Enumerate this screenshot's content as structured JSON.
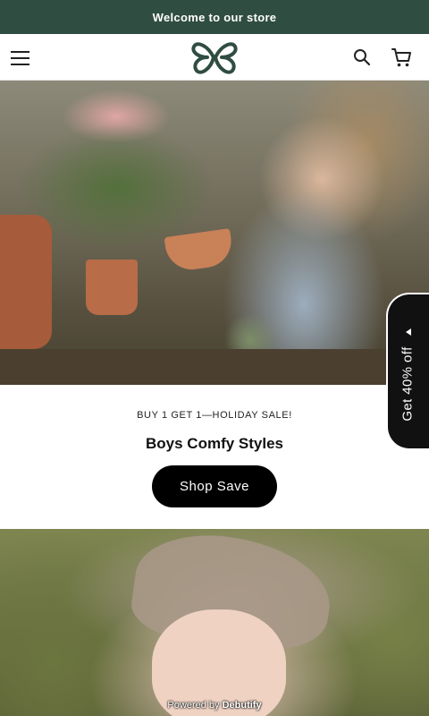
{
  "announcement": {
    "text": "Welcome to our store"
  },
  "header": {
    "menu_icon": "hamburger-menu-icon",
    "logo_icon": "butterfly-logo-icon",
    "search_icon": "search-icon",
    "cart_icon": "cart-icon",
    "logo_color": "#2f4d41"
  },
  "sidetab": {
    "label": "Get 40% off",
    "arrow_icon": "caret-left-icon"
  },
  "promo": {
    "kicker": "BUY 1 GET 1—HOLIDAY SALE!",
    "title": "Boys Comfy Styles",
    "button_label": "Shop Save"
  },
  "footer": {
    "powered_prefix": "Powered by",
    "powered_brand": "Debutify"
  },
  "colors": {
    "announcement_bg": "#2f4d41",
    "button_bg": "#000000",
    "sidetab_bg": "#111111"
  }
}
